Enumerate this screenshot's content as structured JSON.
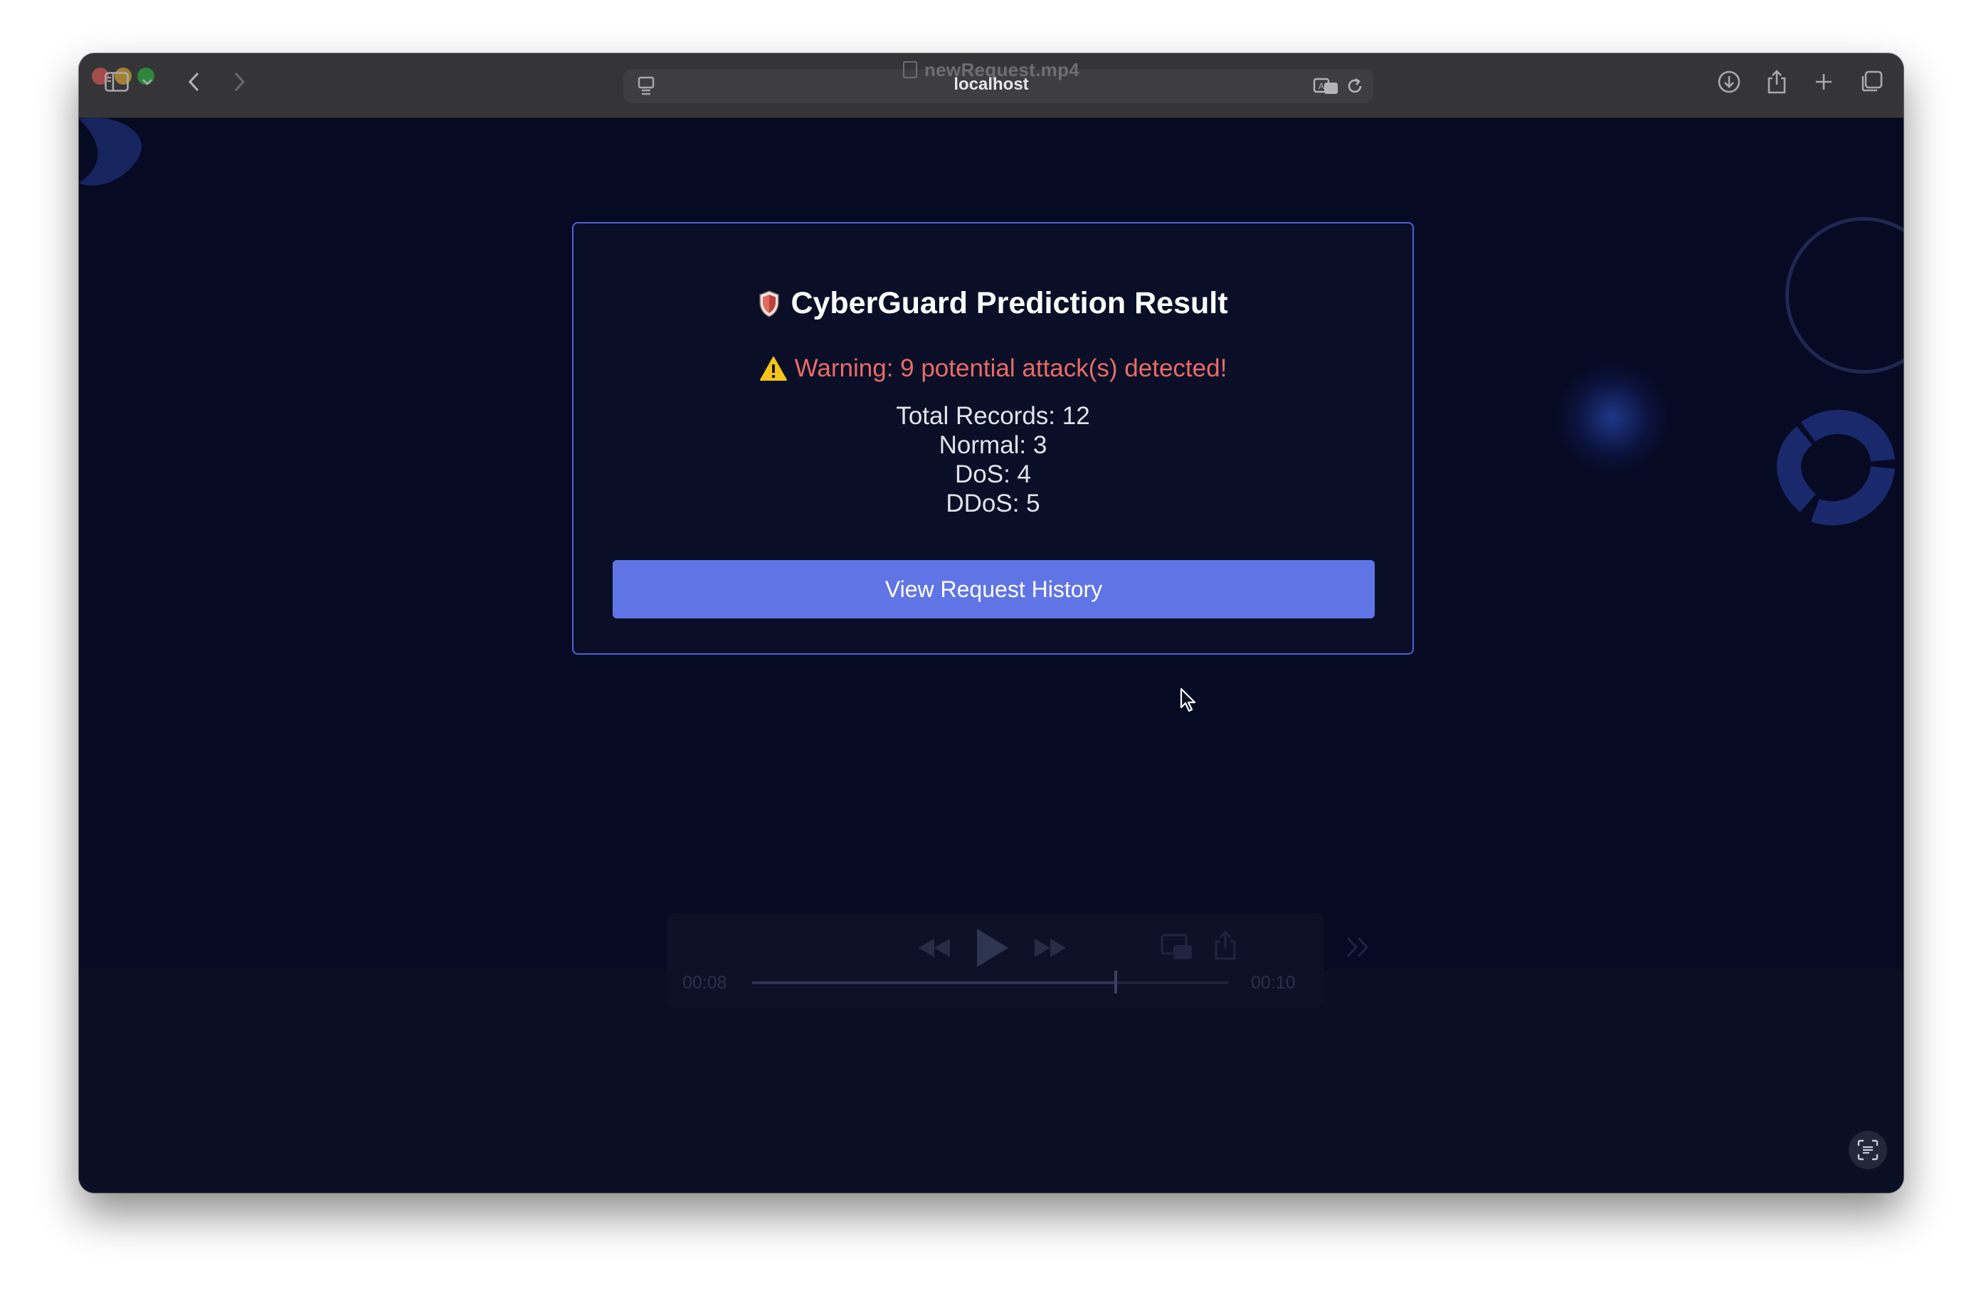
{
  "browser": {
    "tab_title": "newRequest.mp4",
    "url": "localhost",
    "icons": [
      "sidebar-icon",
      "chevron-down-icon",
      "back-icon",
      "forward-icon",
      "reader-icon",
      "translate-icon",
      "reload-icon",
      "download-icon",
      "share-icon",
      "new-tab-icon",
      "tabs-overview-icon"
    ]
  },
  "card": {
    "icon": "shield-icon",
    "title": "CyberGuard Prediction Result",
    "warning_icon": "warning-icon",
    "warning": "Warning: 9 potential attack(s) detected!",
    "stats": {
      "total": "Total Records: 12",
      "normal": "Normal: 3",
      "dos": "DoS: 4",
      "ddos": "DDoS: 5"
    },
    "button_label": "View Request History"
  },
  "video": {
    "current_time": "00:08",
    "duration": "00:10",
    "progress": 0.8
  },
  "colors": {
    "page_bg": "#060a22",
    "card_border": "#4e63d6",
    "button": "#6075e5",
    "warning": "#ea6b67"
  }
}
